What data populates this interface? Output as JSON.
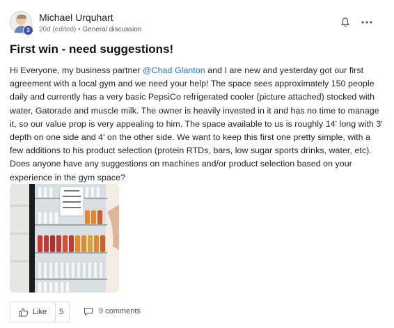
{
  "post": {
    "author": {
      "name": "Michael Urquhart",
      "level": "3"
    },
    "meta": {
      "age": "20d (edited)",
      "separator": "•",
      "category": "General discussion"
    },
    "title": "First win - need suggestions!",
    "body": {
      "part1": "Hi Everyone, my business partner ",
      "mention": "@Chad Glanton",
      "part2": " and I are new and yesterday got our first agreement with a local gym and we need your help! The space sees approximately 150 people daily and currently has a very basic PepsiCo refrigerated cooler (picture attached) stocked with water, Gatorade and muscle milk. The owner is heavily invested in it and has no time to manage it, so our value prop is very appealing to him. The space available to us is roughly 14' long with 3' depth on one side and 4' on the other side. We want to keep this first one pretty simple, with a few additions to his product selection (protein RTDs, bars, low sugar sports drinks, water, etc). Does anyone have any suggestions on machines and/or product selection based on your experience in the gym space?"
    },
    "actions": {
      "like_label": "Like",
      "like_count": "5",
      "comments_label": "9 comments"
    },
    "icons": {
      "bell": "bell-icon",
      "more": "more-horizontal-icon",
      "like": "thumbs-up-icon",
      "comment": "comment-icon"
    }
  },
  "colors": {
    "mention": "#1a73e8",
    "badge": "#3f51b5"
  }
}
